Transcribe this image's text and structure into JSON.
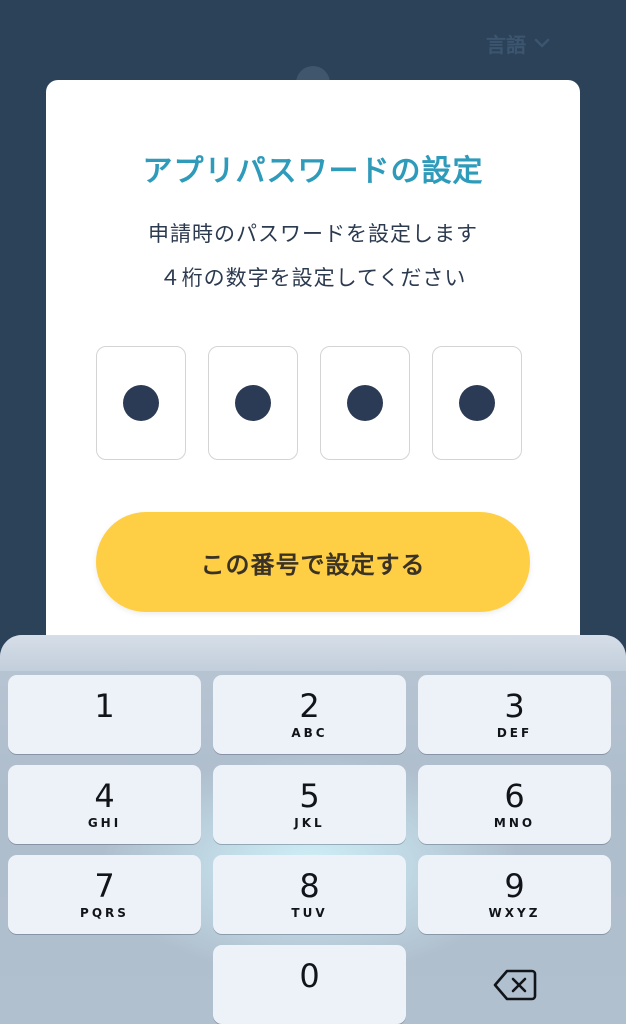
{
  "header": {
    "language_label": "言語"
  },
  "dialog": {
    "title": "アプリパスワードの設定",
    "description_line1": "申請時のパスワードを設定します",
    "description_line2": "４桁の数字を設定してください",
    "pin_digits_entered": 4,
    "pin_length": 4,
    "submit_label": "この番号で設定する"
  },
  "keypad": {
    "keys": [
      {
        "digit": "1",
        "letters": ""
      },
      {
        "digit": "2",
        "letters": "ABC"
      },
      {
        "digit": "3",
        "letters": "DEF"
      },
      {
        "digit": "4",
        "letters": "GHI"
      },
      {
        "digit": "5",
        "letters": "JKL"
      },
      {
        "digit": "6",
        "letters": "MNO"
      },
      {
        "digit": "7",
        "letters": "PQRS"
      },
      {
        "digit": "8",
        "letters": "TUV"
      },
      {
        "digit": "9",
        "letters": "WXYZ"
      },
      {
        "digit": "0",
        "letters": ""
      }
    ],
    "delete_icon": "backspace-icon"
  },
  "colors": {
    "background": "#2c4259",
    "title": "#2f9bbb",
    "button": "#fece44",
    "pin_dot": "#2b3a55"
  }
}
